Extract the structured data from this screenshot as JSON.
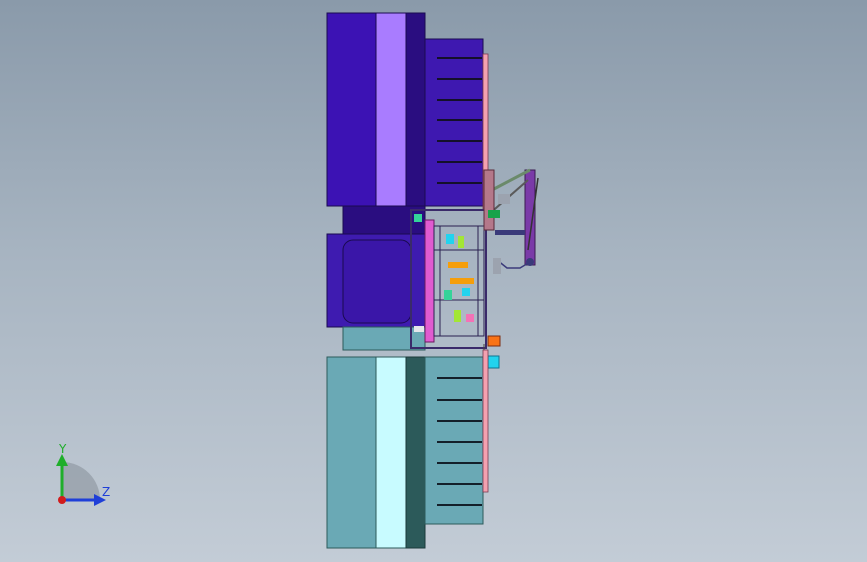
{
  "viewport": {
    "background_top": "#8a9aaa",
    "background_bottom": "#c3ccd6"
  },
  "model": {
    "colors": {
      "upper_block": "#3c12b4",
      "upper_block_light": "#a97cff",
      "upper_block_dark": "#2a0d80",
      "middle_block": "#3e1bb0",
      "frame_pink": "#e05bd0",
      "rail_pink": "#f4a1b0",
      "lower_block": "#6aa9b5",
      "lower_block_light": "#c8fbff",
      "lower_block_dark": "#2c5a5a",
      "arm_purple": "#7a3aa8",
      "slot_dark": "#1a1a2a"
    }
  },
  "triad": {
    "y_label": "Y",
    "z_label": "Z",
    "y_color": "#1fae2a",
    "z_color": "#1f3fd8",
    "x_color": "#d11c1c"
  }
}
